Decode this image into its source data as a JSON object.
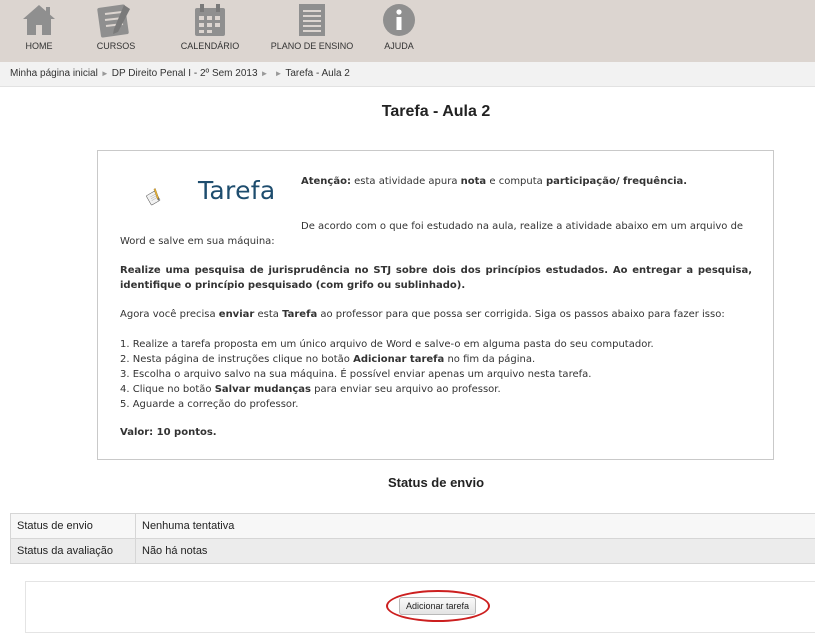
{
  "nav": {
    "items": [
      {
        "label": "HOME",
        "icon": "home-icon"
      },
      {
        "label": "CURSOS",
        "icon": "notebook-pencil-icon"
      },
      {
        "label": "CALENDÁRIO",
        "icon": "calendar-icon"
      },
      {
        "label": "PLANO DE ENSINO",
        "icon": "document-icon"
      },
      {
        "label": "AJUDA",
        "icon": "info-icon"
      }
    ]
  },
  "breadcrumb": {
    "items": [
      "Minha página inicial",
      "DP Direito Penal I - 2º Sem 2013",
      "Tarefa - Aula 2"
    ],
    "separator": "►"
  },
  "page": {
    "title": "Tarefa - Aula 2"
  },
  "intro": {
    "logo_text": "Tarefa",
    "atencao_label": "Atenção:",
    "atencao_text_1": " esta atividade apura ",
    "atencao_nota": "nota",
    "atencao_text_2": " e computa ",
    "atencao_participacao": "participação/ frequência.",
    "p_estudado": "De acordo com o que foi estudado na aula, realize a atividade abaixo em um arquivo de Word e salve em sua máquina:",
    "p_pesquisa": "Realize uma pesquisa de jurisprudência no STJ sobre dois dos princípios estudados. Ao entregar a pesquisa, identifique o princípio pesquisado (com grifo ou sublinhado).",
    "p_agora_1": "Agora você precisa ",
    "p_agora_enviar": "enviar",
    "p_agora_2": " esta ",
    "p_agora_tarefa": "Tarefa",
    "p_agora_3": " ao professor para que possa ser corrigida. Siga os passos abaixo para fazer isso:",
    "step1": "1. Realize a tarefa proposta em um único arquivo de Word e salve-o em alguma pasta do seu computador.",
    "step2_a": "2. Nesta página de instruções clique no botão ",
    "step2_b": "Adicionar tarefa",
    "step2_c": " no fim da página.",
    "step3": "3. Escolha o arquivo salvo na sua máquina. É possível enviar apenas um arquivo nesta tarefa.",
    "step4_a": "4. Clique no botão ",
    "step4_b": "Salvar mudanças",
    "step4_c": " para enviar seu arquivo ao professor.",
    "step5": "5. Aguarde a correção do professor.",
    "valor": "Valor: 10 pontos."
  },
  "status": {
    "heading": "Status de envio",
    "rows": [
      {
        "label": "Status de envio",
        "value": "Nenhuma tentativa"
      },
      {
        "label": "Status da avaliação",
        "value": "Não há notas"
      }
    ]
  },
  "actions": {
    "add_button": "Adicionar tarefa"
  },
  "colors": {
    "nav_bg": "#dcd5d0",
    "logo_text": "#1e4d6e",
    "highlight_ring": "#cc1f1f"
  }
}
